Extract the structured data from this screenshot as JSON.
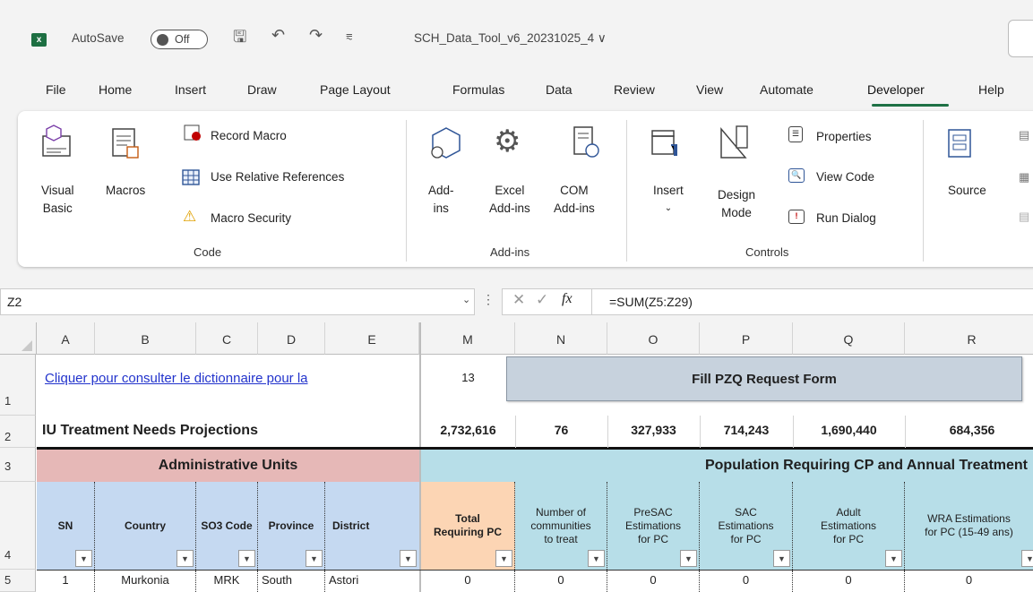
{
  "titlebar": {
    "autosave": "AutoSave",
    "toggle": "Off",
    "filename": "SCH_Data_Tool_v6_20231025_4 ∨"
  },
  "menu": [
    "File",
    "Home",
    "Insert",
    "Draw",
    "Page Layout",
    "Formulas",
    "Data",
    "Review",
    "View",
    "Automate",
    "Developer",
    "Help"
  ],
  "ribbon": {
    "code": {
      "visual_basic_1": "Visual",
      "visual_basic_2": "Basic",
      "macros": "Macros",
      "record": "Record Macro",
      "relative": "Use Relative References",
      "security": "Macro Security",
      "group": "Code"
    },
    "addins": {
      "addins_1": "Add-",
      "addins_2": "ins",
      "excel_1": "Excel",
      "excel_2": "Add-ins",
      "com_1": "COM",
      "com_2": "Add-ins",
      "group": "Add-ins"
    },
    "controls": {
      "insert": "Insert",
      "design_1": "Design",
      "design_2": "Mode",
      "properties": "Properties",
      "view_code": "View Code",
      "run_dialog": "Run Dialog",
      "group": "Controls"
    },
    "xml": {
      "source": "Source"
    }
  },
  "formula_bar": {
    "name_box": "Z2",
    "formula": "=SUM(Z5:Z29)"
  },
  "columns": [
    "A",
    "B",
    "C",
    "D",
    "E",
    "M",
    "N",
    "O",
    "P",
    "Q",
    "R"
  ],
  "rows": [
    "1",
    "2",
    "3",
    "4",
    "5"
  ],
  "sheet": {
    "link": "Cliquer pour consulter le dictionnaire pour la",
    "m1": "13",
    "button": "Fill PZQ Request Form",
    "title": "IU Treatment Needs Projections",
    "totals": [
      "2,732,616",
      "76",
      "327,933",
      "714,243",
      "1,690,440",
      "684,356"
    ],
    "admin_header": "Administrative Units",
    "pop_header": "Population Requiring CP and Annual Treatment",
    "hdr": {
      "sn": "SN",
      "country": "Country",
      "iso": "SO3 Code",
      "province": "Province",
      "district": "District",
      "m": [
        "Total",
        "Requiring PC"
      ],
      "n": [
        "Number of",
        "communities",
        "to treat"
      ],
      "o": [
        "PreSAC",
        "Estimations",
        "for PC"
      ],
      "p": [
        "SAC",
        "Estimations",
        "for PC"
      ],
      "q": [
        "Adult",
        "Estimations",
        "for PC"
      ],
      "r": [
        "WRA Estimations",
        "for PC (15-49 ans)"
      ]
    },
    "row5": {
      "sn": "1",
      "country": "Murkonia",
      "iso": "MRK",
      "province": "South",
      "district": "Astori",
      "vals": [
        "0",
        "0",
        "0",
        "0",
        "0",
        "0"
      ]
    }
  },
  "colors": {
    "admin": "#e6b8b7",
    "pop": "#b7dee8",
    "blue_hdr": "#c5d9f1",
    "orange_hdr": "#fcd5b4",
    "accent": "#1e7145"
  }
}
